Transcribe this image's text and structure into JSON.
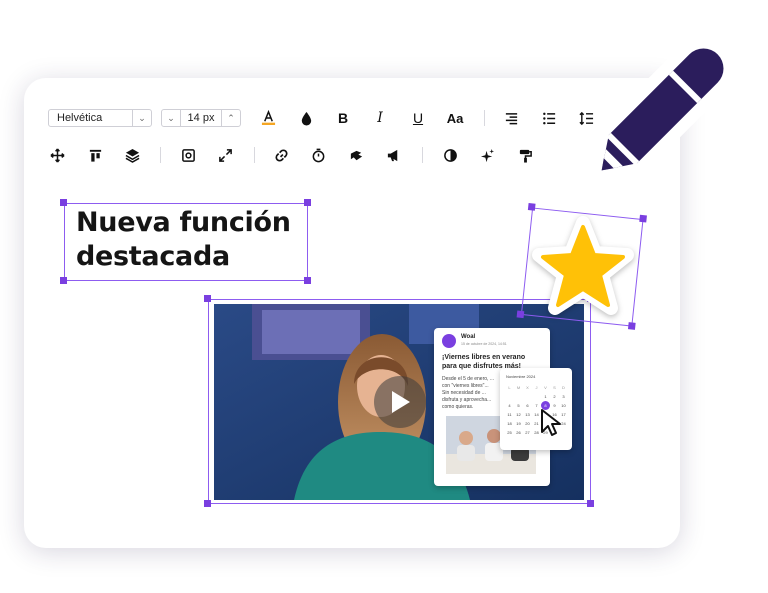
{
  "toolbar": {
    "font_family": "Helvética",
    "font_size": "14 px",
    "row1_icons": [
      "text-color-icon",
      "fill-color-icon",
      "bold-icon",
      "italic-icon",
      "underline-icon",
      "text-case-icon",
      "align-right-icon",
      "bullet-list-icon",
      "line-spacing-icon"
    ],
    "row1_glyphs": {
      "bold": "B",
      "italic": "I",
      "underline": "U",
      "case": "Aa"
    },
    "row2_icons": [
      "move-icon",
      "align-top-icon",
      "layers-icon",
      "frame-icon",
      "expand-icon",
      "link-icon",
      "timer-icon",
      "animation-icon",
      "announce-icon",
      "contrast-icon",
      "sparkle-icon",
      "paint-roller-icon"
    ]
  },
  "headline": {
    "line1": "Nueva función",
    "line2": "destacada"
  },
  "video": {
    "post": {
      "author": "Woal",
      "date": "15 de octubre de 2024, 14:51",
      "title_line1": "¡Viernes libres en verano",
      "title_line2": "para que disfrutes más!",
      "body_lines": [
        "Desde el 5 de enero, ...",
        "con \"viernes libres\"...",
        "Sin necesidad de ...",
        "disfruta y aprovecha...",
        "como quieras."
      ]
    },
    "calendar": {
      "month": "Noviembre 2024",
      "weekdays": [
        "L",
        "M",
        "X",
        "J",
        "V",
        "S",
        "D"
      ],
      "days": [
        "",
        "",
        "",
        "",
        "1",
        "2",
        "3",
        "4",
        "5",
        "6",
        "7",
        "8",
        "9",
        "10",
        "11",
        "12",
        "13",
        "14",
        "15",
        "16",
        "17",
        "18",
        "19",
        "20",
        "21",
        "22",
        "23",
        "24",
        "25",
        "26",
        "27",
        "28",
        "29",
        "30",
        ""
      ],
      "selected": "8"
    }
  },
  "colors": {
    "accent": "#7a3fe0",
    "pencil": "#2b1d5c",
    "star": "#ffc107",
    "underline": "#f5a623"
  }
}
